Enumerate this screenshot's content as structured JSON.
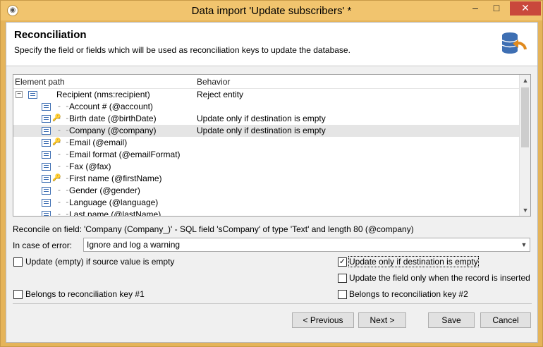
{
  "window": {
    "title": "Data import 'Update subscribers' *",
    "min_glyph": "–",
    "max_glyph": "□",
    "close_glyph": "✕"
  },
  "header": {
    "title": "Reconciliation",
    "subtitle": "Specify the field or fields which will be used as reconciliation keys to update the database."
  },
  "tree": {
    "col_element": "Element path",
    "col_behavior": "Behavior",
    "rows": [
      {
        "name": "Recipient (nms:recipient)",
        "behavior": "Reject entity",
        "key": false,
        "root": true
      },
      {
        "name": "Account # (@account)",
        "behavior": "",
        "key": false
      },
      {
        "name": "Birth date (@birthDate)",
        "behavior": "Update only if destination is empty",
        "key": true
      },
      {
        "name": "Company (@company)",
        "behavior": "Update only if destination is empty",
        "key": false,
        "selected": true
      },
      {
        "name": "Email (@email)",
        "behavior": "",
        "key": true
      },
      {
        "name": "Email format (@emailFormat)",
        "behavior": "",
        "key": false
      },
      {
        "name": "Fax (@fax)",
        "behavior": "",
        "key": false
      },
      {
        "name": "First name (@firstName)",
        "behavior": "",
        "key": true
      },
      {
        "name": "Gender (@gender)",
        "behavior": "",
        "key": false
      },
      {
        "name": "Language (@language)",
        "behavior": "",
        "key": false
      },
      {
        "name": "Last name (@lastName)",
        "behavior": "",
        "key": false
      }
    ]
  },
  "reconcile": {
    "label": "Reconcile on field:",
    "value": "'Company  (Company_)' - SQL field 'sCompany' of type 'Text' and length 80 (@company)"
  },
  "error": {
    "label": "In case of error:",
    "value": "Ignore and log a warning"
  },
  "options": {
    "update_empty": {
      "label": "Update (empty) if source value is empty",
      "checked": false
    },
    "update_if_dest_empty": {
      "label": "Update only if destination is empty",
      "checked": true
    },
    "update_only_inserted": {
      "label": "Update the field only when the record is inserted",
      "checked": false
    },
    "key1": {
      "label": "Belongs to reconciliation key #1",
      "checked": false
    },
    "key2": {
      "label": "Belongs to reconciliation key #2",
      "checked": false
    }
  },
  "buttons": {
    "previous": "< Previous",
    "next": "Next >",
    "save": "Save",
    "cancel": "Cancel"
  },
  "icons": {
    "app": "app-icon",
    "database": "database-update-icon",
    "list": "list-icon",
    "key": "key-icon"
  },
  "colors": {
    "titlebar": "#f1c46e",
    "close_button": "#c9483c",
    "icon_blue": "#3e6fb3",
    "icon_orange": "#e08a1e"
  }
}
